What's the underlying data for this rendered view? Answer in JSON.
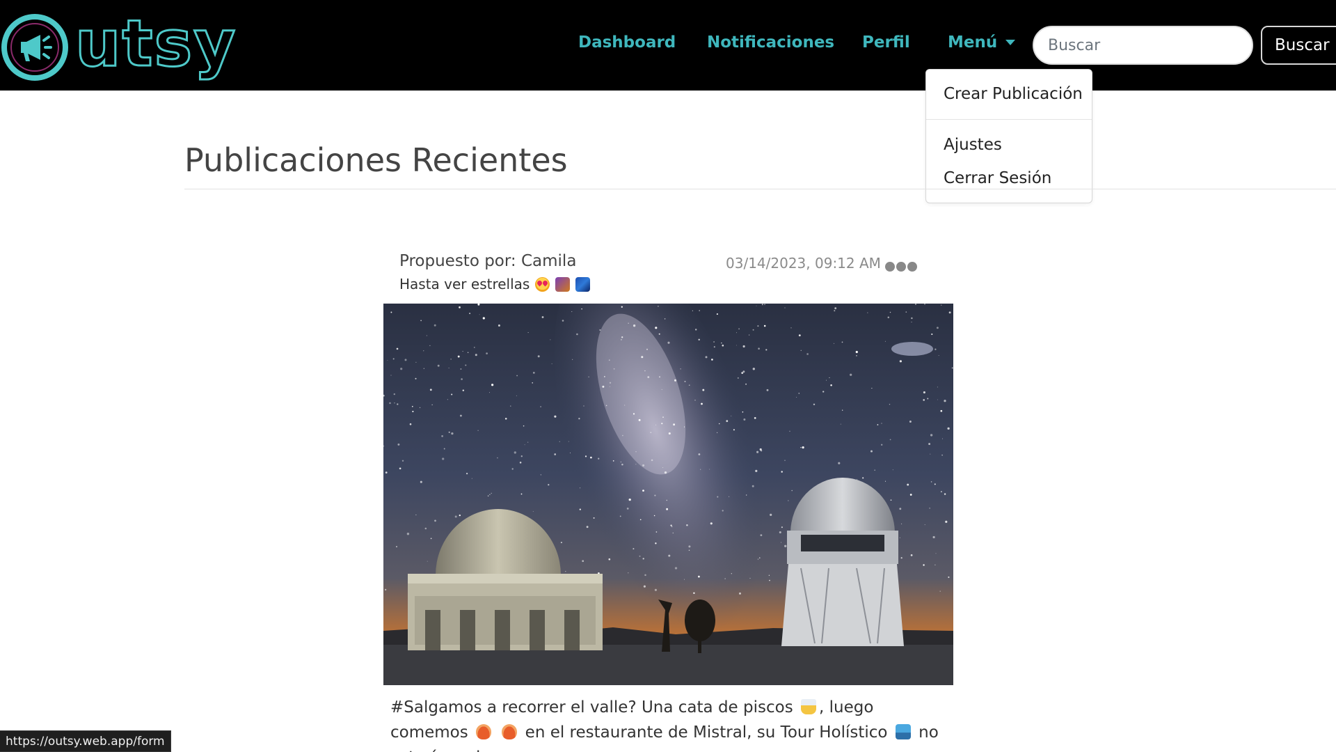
{
  "brand": {
    "logo_text": "utsy",
    "accent": "#4ec9c9"
  },
  "nav": {
    "links": [
      {
        "label": "Dashboard"
      },
      {
        "label": "Notificaciones"
      },
      {
        "label": "Perfil"
      },
      {
        "label": "Menú"
      }
    ],
    "search_placeholder": "Buscar",
    "search_button": "Buscar",
    "link_color": "#3fb7bd"
  },
  "dropdown": {
    "items": [
      {
        "label": "Crear Publicación"
      },
      {
        "label": "Ajustes"
      },
      {
        "label": "Cerrar Sesión"
      }
    ]
  },
  "page": {
    "title": "Publicaciones Recientes"
  },
  "post": {
    "author": "Propuesto por: Camila",
    "date": "03/14/2023, 09:12 AM",
    "subtitle": "Hasta ver estrellas",
    "subtitle_emojis": [
      "star-struck-icon",
      "shooting-star-icon",
      "milky-way-icon"
    ],
    "body_part1": "#Salgamos a recorrer el valle? Una cata de piscos",
    "body_part2": ", luego comemos",
    "body_part3": "en el restaurante de Mistral, su Tour Holístico",
    "body_part4": "no estaría mal y"
  },
  "status_bar": {
    "url": "https://outsy.web.app/form"
  }
}
